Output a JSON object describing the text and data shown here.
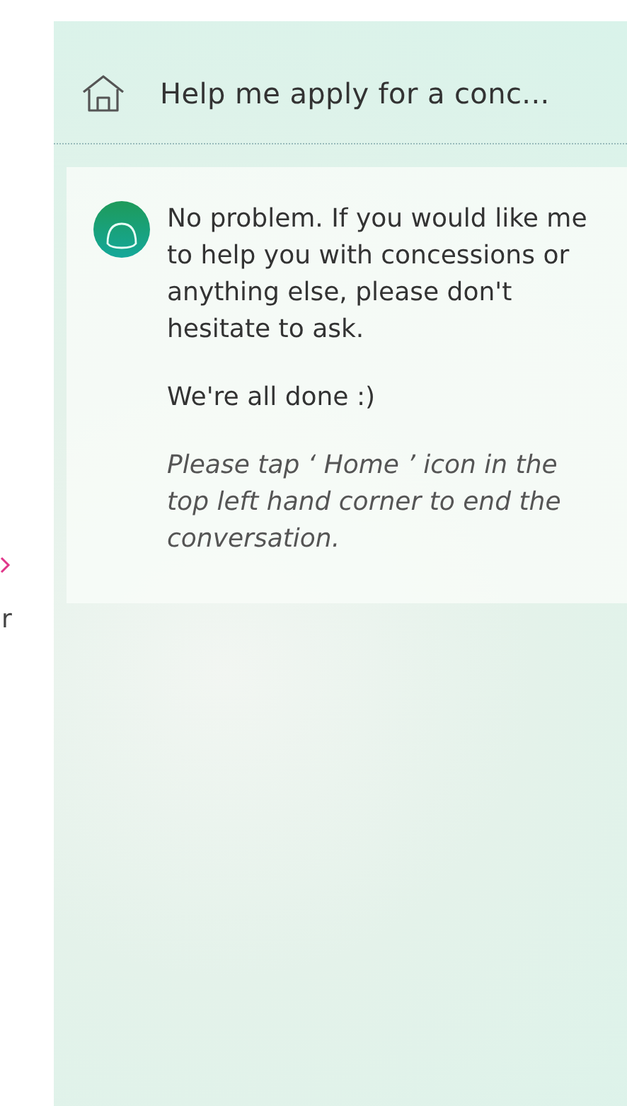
{
  "side_fragment": {
    "text": "r"
  },
  "header": {
    "title": "Help me apply for a conc..."
  },
  "message": {
    "paragraphs": [
      {
        "kind": "plain",
        "text": "No problem. If you would like me to help you with concessions or anything else, please don't hesitate to ask."
      },
      {
        "kind": "plain",
        "text": "We're all done :)"
      },
      {
        "kind": "italic",
        "text": "Please tap ‘ Home ’ icon in the top left hand corner to end the conversation."
      }
    ]
  }
}
